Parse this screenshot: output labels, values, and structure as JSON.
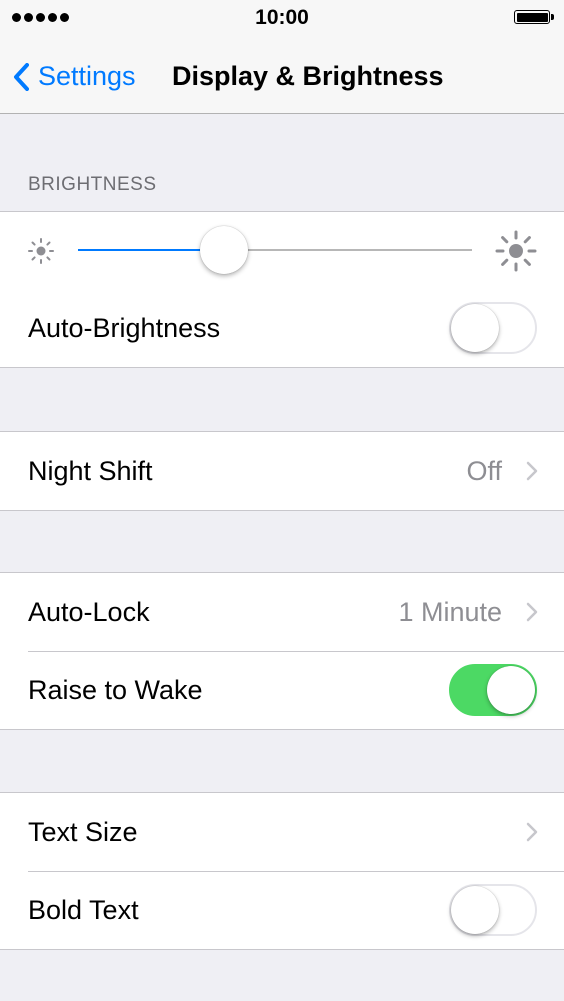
{
  "status_bar": {
    "time": "10:00",
    "signal_icon": "signal-dots-icon",
    "battery_icon": "battery-full-icon"
  },
  "nav": {
    "back_label": "Settings",
    "back_icon": "chevron-left-icon",
    "title": "Display & Brightness",
    "accent_color": "#007aff"
  },
  "brightness": {
    "header": "BRIGHTNESS",
    "level": 0.37,
    "min_icon": "sun-small-icon",
    "max_icon": "sun-large-icon",
    "auto_brightness": {
      "label": "Auto-Brightness",
      "on": false
    }
  },
  "night_shift": {
    "label": "Night Shift",
    "value": "Off"
  },
  "lock": {
    "auto_lock": {
      "label": "Auto-Lock",
      "value": "1 Minute"
    },
    "raise_to_wake": {
      "label": "Raise to Wake",
      "on": true
    }
  },
  "text": {
    "text_size": {
      "label": "Text Size"
    },
    "bold_text": {
      "label": "Bold Text",
      "on": false
    }
  },
  "colors": {
    "toggle_on": "#4cd964",
    "background": "#efeff4"
  }
}
